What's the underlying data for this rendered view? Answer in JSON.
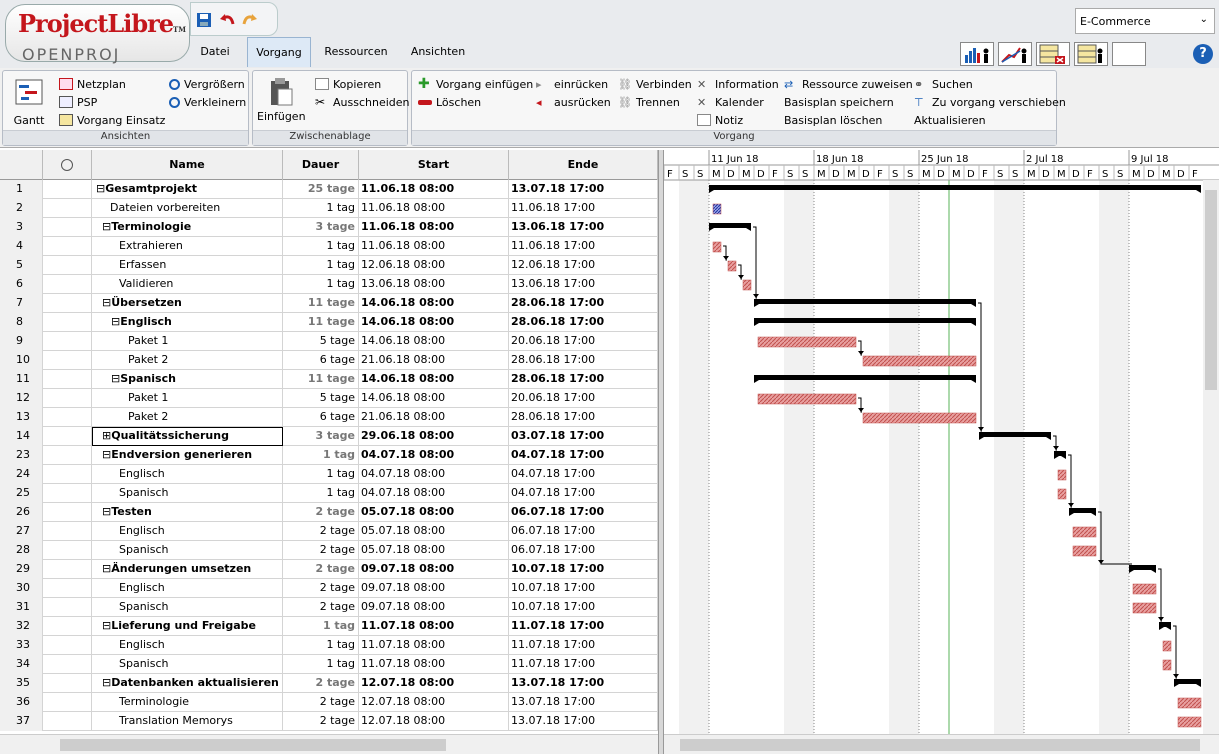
{
  "app": {
    "logo_top": "ProjectLibre",
    "logo_tm": "TM",
    "logo_bottom": "OPENPROJ",
    "project_selector": "E-Commerce"
  },
  "tabs": [
    {
      "label": "Datei"
    },
    {
      "label": "Vorgang"
    },
    {
      "label": "Ressourcen"
    },
    {
      "label": "Ansichten"
    }
  ],
  "ribbon": {
    "ansichten": {
      "caption": "Ansichten",
      "gantt": "Gantt",
      "netzplan": "Netzplan",
      "psp": "PSP",
      "vorgang_einsatz": "Vorgang Einsatz",
      "vergroessern": "Vergrößern",
      "verkleinern": "Verkleinern"
    },
    "zwischenablage": {
      "caption": "Zwischenablage",
      "einfuegen": "Einfügen",
      "kopieren": "Kopieren",
      "ausschneiden": "Ausschneiden"
    },
    "vorgang": {
      "caption": "Vorgang",
      "vorgang_einfuegen": "Vorgang einfügen",
      "loeschen": "Löschen",
      "einruecken": "einrücken",
      "ausruecken": "ausrücken",
      "verbinden": "Verbinden",
      "trennen": "Trennen",
      "information": "Information",
      "kalender": "Kalender",
      "notiz": "Notiz",
      "ressource_zuweisen": "Ressource zuweisen",
      "basisplan_speichern": "Basisplan speichern",
      "basisplan_loeschen": "Basisplan löschen",
      "suchen": "Suchen",
      "zu_vorgang": "Zu vorgang verschieben",
      "aktualisieren": "Aktualisieren"
    }
  },
  "table": {
    "headers": {
      "name": "Name",
      "dauer": "Dauer",
      "start": "Start",
      "ende": "Ende"
    },
    "rows": [
      {
        "id": "1",
        "name": "Gesamtprojekt",
        "dur": "25 tage",
        "start": "11.06.18 08:00",
        "end": "13.07.18 17:00",
        "level": 0,
        "summary": true,
        "expander": "⊟"
      },
      {
        "id": "2",
        "name": "Dateien vorbereiten",
        "dur": "1 tag",
        "start": "11.06.18 08:00",
        "end": "11.06.18 17:00",
        "level": 1,
        "summary": false,
        "expander": ""
      },
      {
        "id": "3",
        "name": "Terminologie",
        "dur": "3 tage",
        "start": "11.06.18 08:00",
        "end": "13.06.18 17:00",
        "level": 1,
        "summary": true,
        "expander": "⊟"
      },
      {
        "id": "4",
        "name": "Extrahieren",
        "dur": "1 tag",
        "start": "11.06.18 08:00",
        "end": "11.06.18 17:00",
        "level": 2,
        "summary": false,
        "expander": ""
      },
      {
        "id": "5",
        "name": "Erfassen",
        "dur": "1 tag",
        "start": "12.06.18 08:00",
        "end": "12.06.18 17:00",
        "level": 2,
        "summary": false,
        "expander": ""
      },
      {
        "id": "6",
        "name": "Validieren",
        "dur": "1 tag",
        "start": "13.06.18 08:00",
        "end": "13.06.18 17:00",
        "level": 2,
        "summary": false,
        "expander": ""
      },
      {
        "id": "7",
        "name": "Übersetzen",
        "dur": "11 tage",
        "start": "14.06.18 08:00",
        "end": "28.06.18 17:00",
        "level": 1,
        "summary": true,
        "expander": "⊟"
      },
      {
        "id": "8",
        "name": "Englisch",
        "dur": "11 tage",
        "start": "14.06.18 08:00",
        "end": "28.06.18 17:00",
        "level": 2,
        "summary": true,
        "expander": "⊟"
      },
      {
        "id": "9",
        "name": "Paket 1",
        "dur": "5 tage",
        "start": "14.06.18 08:00",
        "end": "20.06.18 17:00",
        "level": 3,
        "summary": false,
        "expander": ""
      },
      {
        "id": "10",
        "name": "Paket 2",
        "dur": "6 tage",
        "start": "21.06.18 08:00",
        "end": "28.06.18 17:00",
        "level": 3,
        "summary": false,
        "expander": ""
      },
      {
        "id": "11",
        "name": "Spanisch",
        "dur": "11 tage",
        "start": "14.06.18 08:00",
        "end": "28.06.18 17:00",
        "level": 2,
        "summary": true,
        "expander": "⊟"
      },
      {
        "id": "12",
        "name": "Paket 1",
        "dur": "5 tage",
        "start": "14.06.18 08:00",
        "end": "20.06.18 17:00",
        "level": 3,
        "summary": false,
        "expander": ""
      },
      {
        "id": "13",
        "name": "Paket 2",
        "dur": "6 tage",
        "start": "21.06.18 08:00",
        "end": "28.06.18 17:00",
        "level": 3,
        "summary": false,
        "expander": ""
      },
      {
        "id": "14",
        "name": "Qualitätssicherung",
        "dur": "3 tage",
        "start": "29.06.18 08:00",
        "end": "03.07.18 17:00",
        "level": 1,
        "summary": true,
        "expander": "⊞",
        "selected": true
      },
      {
        "id": "23",
        "name": "Endversion generieren",
        "dur": "1 tag",
        "start": "04.07.18 08:00",
        "end": "04.07.18 17:00",
        "level": 1,
        "summary": true,
        "expander": "⊟"
      },
      {
        "id": "24",
        "name": "Englisch",
        "dur": "1 tag",
        "start": "04.07.18 08:00",
        "end": "04.07.18 17:00",
        "level": 2,
        "summary": false,
        "expander": ""
      },
      {
        "id": "25",
        "name": "Spanisch",
        "dur": "1 tag",
        "start": "04.07.18 08:00",
        "end": "04.07.18 17:00",
        "level": 2,
        "summary": false,
        "expander": ""
      },
      {
        "id": "26",
        "name": "Testen",
        "dur": "2 tage",
        "start": "05.07.18 08:00",
        "end": "06.07.18 17:00",
        "level": 1,
        "summary": true,
        "expander": "⊟"
      },
      {
        "id": "27",
        "name": "Englisch",
        "dur": "2 tage",
        "start": "05.07.18 08:00",
        "end": "06.07.18 17:00",
        "level": 2,
        "summary": false,
        "expander": ""
      },
      {
        "id": "28",
        "name": "Spanisch",
        "dur": "2 tage",
        "start": "05.07.18 08:00",
        "end": "06.07.18 17:00",
        "level": 2,
        "summary": false,
        "expander": ""
      },
      {
        "id": "29",
        "name": "Änderungen umsetzen",
        "dur": "2 tage",
        "start": "09.07.18 08:00",
        "end": "10.07.18 17:00",
        "level": 1,
        "summary": true,
        "expander": "⊟"
      },
      {
        "id": "30",
        "name": "Englisch",
        "dur": "2 tage",
        "start": "09.07.18 08:00",
        "end": "10.07.18 17:00",
        "level": 2,
        "summary": false,
        "expander": ""
      },
      {
        "id": "31",
        "name": "Spanisch",
        "dur": "2 tage",
        "start": "09.07.18 08:00",
        "end": "10.07.18 17:00",
        "level": 2,
        "summary": false,
        "expander": ""
      },
      {
        "id": "32",
        "name": "Lieferung und Freigabe",
        "dur": "1 tag",
        "start": "11.07.18 08:00",
        "end": "11.07.18 17:00",
        "level": 1,
        "summary": true,
        "expander": "⊟"
      },
      {
        "id": "33",
        "name": "Englisch",
        "dur": "1 tag",
        "start": "11.07.18 08:00",
        "end": "11.07.18 17:00",
        "level": 2,
        "summary": false,
        "expander": ""
      },
      {
        "id": "34",
        "name": "Spanisch",
        "dur": "1 tag",
        "start": "11.07.18 08:00",
        "end": "11.07.18 17:00",
        "level": 2,
        "summary": false,
        "expander": ""
      },
      {
        "id": "35",
        "name": "Datenbanken aktualisieren",
        "dur": "2 tage",
        "start": "12.07.18 08:00",
        "end": "13.07.18 17:00",
        "level": 1,
        "summary": true,
        "expander": "⊟"
      },
      {
        "id": "36",
        "name": "Terminologie",
        "dur": "2 tage",
        "start": "12.07.18 08:00",
        "end": "13.07.18 17:00",
        "level": 2,
        "summary": false,
        "expander": ""
      },
      {
        "id": "37",
        "name": "Translation Memorys",
        "dur": "2 tage",
        "start": "12.07.18 08:00",
        "end": "13.07.18 17:00",
        "level": 2,
        "summary": false,
        "expander": ""
      }
    ]
  },
  "gantt": {
    "weeks": [
      "11 Jun 18",
      "18 Jun 18",
      "25 Jun 18",
      "2 Jul 18",
      "9 Jul 18"
    ],
    "day_letters": [
      "F",
      "S",
      "S",
      "M",
      "D",
      "M",
      "D",
      "F",
      "S",
      "S",
      "M",
      "D",
      "M",
      "D",
      "F",
      "S",
      "S",
      "M",
      "D",
      "M",
      "D",
      "F",
      "S",
      "S",
      "M",
      "D",
      "M",
      "D",
      "F",
      "S",
      "S",
      "M",
      "D",
      "M",
      "D",
      "F"
    ],
    "today_offset_days": 19,
    "bar_color": "#c0504d",
    "summary_color": "#000000"
  },
  "colors": {
    "accent": "#1b5fb5",
    "brand": "#c4161c"
  }
}
